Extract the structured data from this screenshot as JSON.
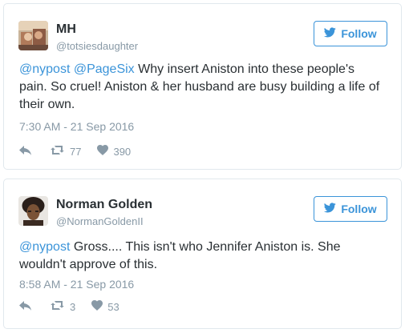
{
  "tweets": [
    {
      "name": "MH",
      "handle": "@totsiesdaughter",
      "follow_label": "Follow",
      "mention1": "@nypost",
      "mention2": "@PageSix",
      "body": " Why insert Aniston into these people's pain. So cruel! Aniston & her husband are busy building a life of their own.",
      "timestamp": "7:30 AM - 21 Sep 2016",
      "retweets": "77",
      "likes": "390"
    },
    {
      "name": "Norman Golden",
      "handle": "@NormanGoldenII",
      "follow_label": "Follow",
      "mention1": "@nypost",
      "body": " Gross.... This isn't who Jennifer Aniston is. She wouldn't approve of this.",
      "timestamp": "8:58 AM - 21 Sep 2016",
      "retweets": "3",
      "likes": "53"
    }
  ],
  "colors": {
    "link": "#3b94d9",
    "muted": "#8899a6",
    "text": "#292f33",
    "border": "#e1e8ed"
  },
  "icons": {
    "follow": "twitter-bird-icon",
    "reply": "reply-icon",
    "retweet": "retweet-icon",
    "like": "heart-icon"
  }
}
